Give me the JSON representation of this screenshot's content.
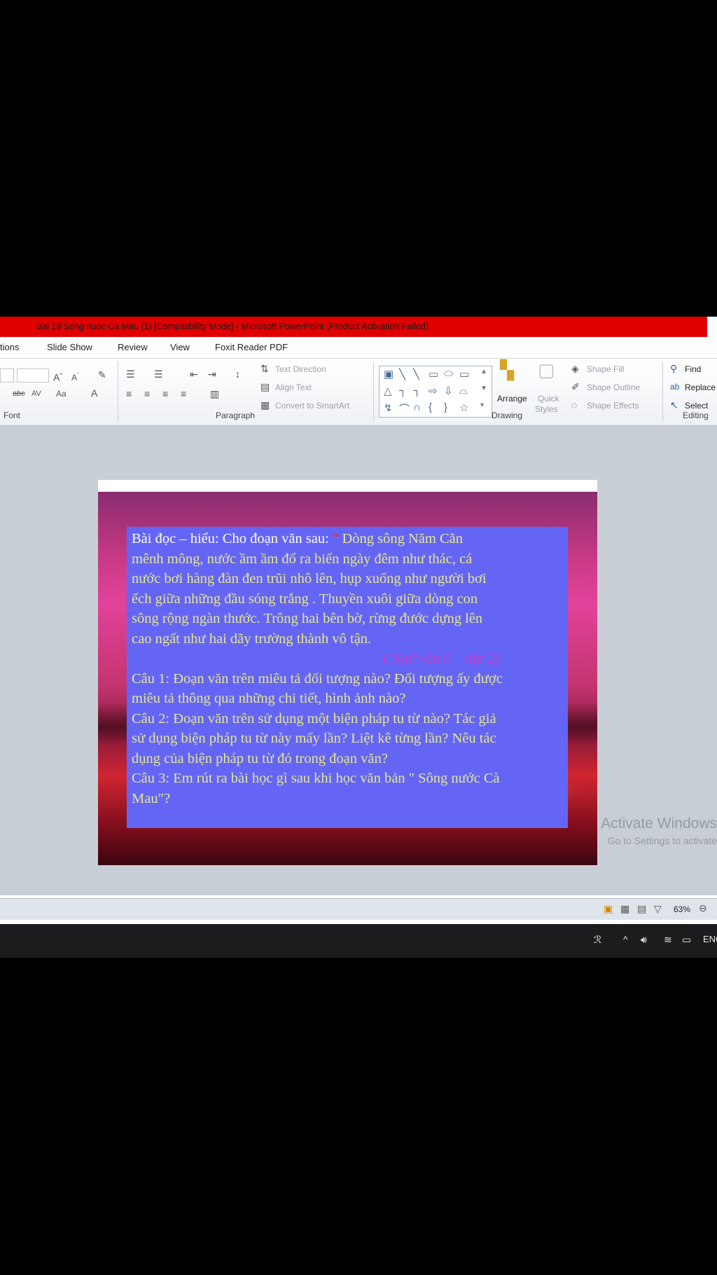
{
  "window": {
    "title": "Bai 19 Song nuoc Ca Mau (1) [Compatibility Mode] - Microsoft PowerPoint (Product Activation Failed)"
  },
  "tabs": [
    "tions",
    "Slide Show",
    "Review",
    "View",
    "Foxit Reader PDF"
  ],
  "ribbon": {
    "font_group_label": "Font",
    "paragraph_group_label": "Paragraph",
    "drawing_group_label": "Drawing",
    "editing_group_label": "Editing",
    "text_direction": "Text Direction",
    "align_text": "Align Text",
    "convert_smartart": "Convert to SmartArt",
    "arrange": "Arrange",
    "quick_styles_1": "Quick",
    "quick_styles_2": "Styles",
    "shape_fill": "Shape Fill",
    "shape_outline": "Shape Outline",
    "shape_effects": "Shape Effects",
    "find": "Find",
    "replace": "Replace",
    "select": "Select"
  },
  "slide": {
    "intro_label": "Bài  đọc – hiểu: Cho đoạn văn sau: ",
    "intro_mark": "\"",
    "passage_1": "Dòng sông Năm Căn",
    "passage_2": "mênh mông, nước ầm ầm đổ ra biển ngày đêm như thác, cá",
    "passage_3": "nước bơi hàng đàn đen trũi nhô lên, hụp xuống như người bơi",
    "passage_4": "ếch giữa những đầu sóng trắng . Thuyền xuôi giữa dòng con",
    "passage_5": "sông rộng ngàn thước. Trông hai bên bờ, rừng đước dựng lên",
    "passage_6": "cao ngất như hai dãy trường thành vô tận.",
    "source": "( Ngữ văn 6 – tập 2)",
    "q1_a": "Câu 1: Đoạn văn trên miêu tả đối tượng nào? Đối tượng ấy được",
    "q1_b": "miêu tả thông qua những chi tiết, hình ảnh nào?",
    "q2_a": "Câu 2: Đoạn văn trên  sử dụng một biện pháp tu từ nào? Tác giả",
    "q2_b": "sử dụng biện pháp tu từ này mấy lần? Liệt kê từng lần? Nêu tác",
    "q2_c": "dụng của biện pháp tu từ đó trong đoạn văn?",
    "q3_a": "Câu 3: Em rút ra bài học gì sau khi học văn bản \" Sông nước Cà",
    "q3_b": "Mau\"?"
  },
  "watermark": {
    "line1": "Activate Windows",
    "line2": "Go to Settings to activate"
  },
  "statusbar": {
    "zoom": "63%"
  },
  "taskbar": {
    "language": "ENG"
  },
  "colors": {
    "titlebar": "#e00000",
    "textbox": "#6565f5",
    "slide_text": "#e6e88a",
    "source_text": "#c83cc8"
  }
}
